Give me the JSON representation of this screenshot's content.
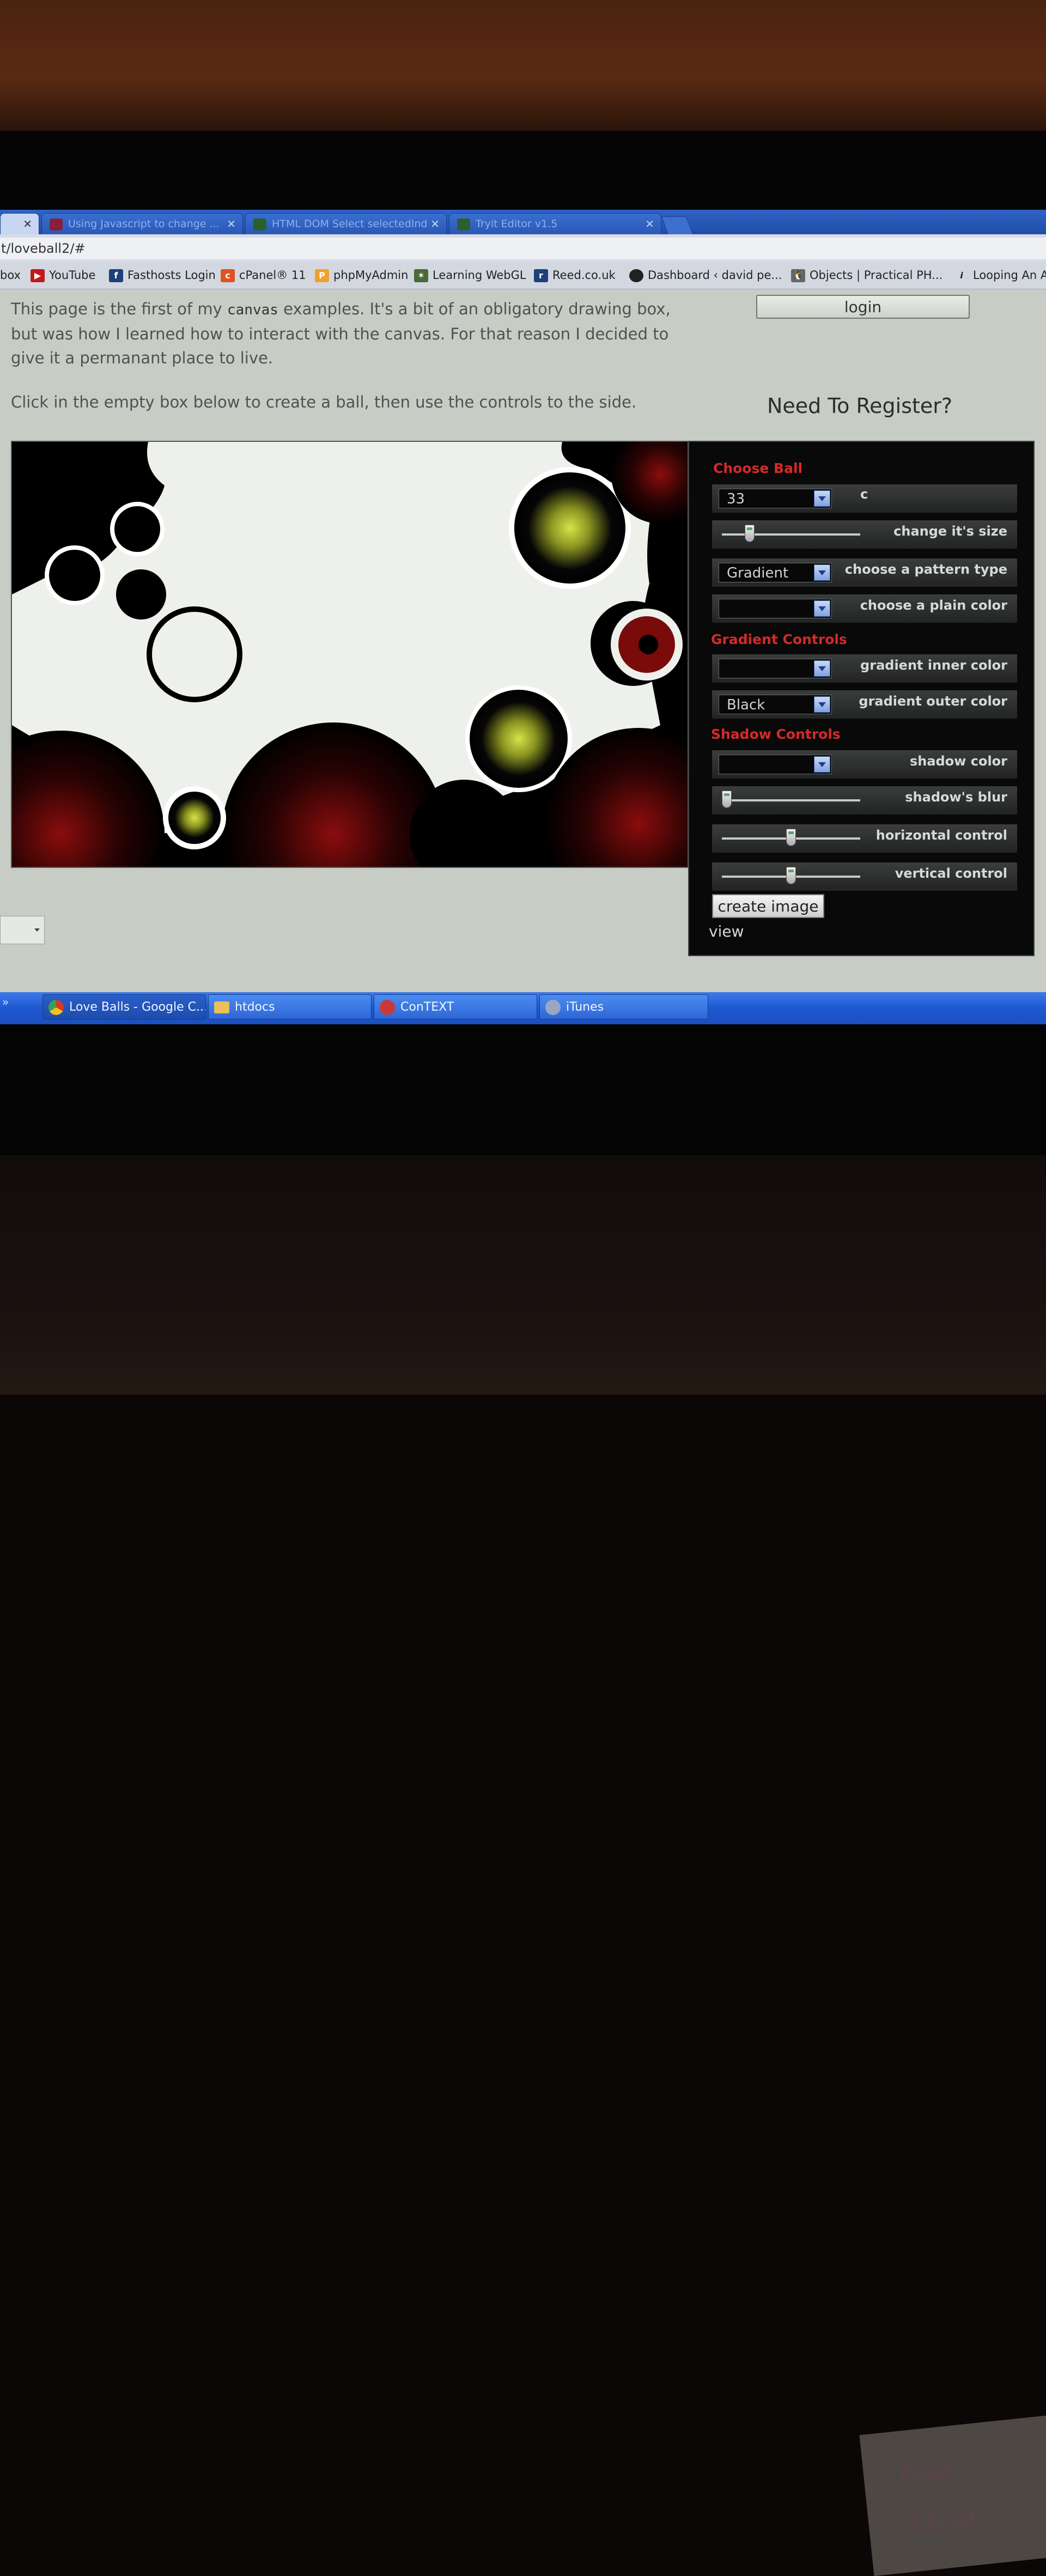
{
  "browser": {
    "tabs": [
      {
        "label": "",
        "active": true
      },
      {
        "label": "Using Javascript to change ...",
        "active": false
      },
      {
        "label": "HTML DOM Select selectedInd",
        "active": false
      },
      {
        "label": "Tryit Editor v1.5",
        "active": false
      }
    ],
    "address": "t/loveball2/#",
    "bookmarks": [
      "box",
      "YouTube",
      "Fasthosts Login",
      "cPanel® 11",
      "phpMyAdmin",
      "Learning WebGL",
      "Reed.co.uk",
      "Dashboard ‹ david pe...",
      "Objects | Practical PH...",
      "Looping An A"
    ]
  },
  "page": {
    "intro_before": "This page is the first of my ",
    "intro_code": "canvas",
    "intro_after": " examples. It's a bit of an obligatory drawing box, but was how I learned how to interact with the canvas. For that reason I decided to give it a permanant place to live.",
    "instruction": "Click in the empty box below to create a ball, then use the controls to the side.",
    "login_label": "login",
    "register_heading": "Need To Register?"
  },
  "controls": {
    "choose_ball_title": "Choose Ball",
    "ball_select_value": "33",
    "ball_select_extra": "c",
    "size_label": "change it's size",
    "size_level": 0.18,
    "pattern_select_value": "Gradient",
    "pattern_label": "choose a pattern type",
    "plain_color_value": "",
    "plain_color_label": "choose a plain color",
    "gradient_title": "Gradient Controls",
    "inner_color_value": "",
    "inner_color_label": "gradient inner color",
    "outer_color_value": "Black",
    "outer_color_label": "gradient outer color",
    "shadow_title": "Shadow Controls",
    "shadow_color_value": "",
    "shadow_color_label": "shadow color",
    "blur_label": "shadow's blur",
    "blur_level": 0.0,
    "horizontal_label": "horizontal control",
    "horizontal_level": 0.5,
    "vertical_label": "vertical control",
    "vertical_level": 0.5,
    "create_label": "create image",
    "view_label": "view"
  },
  "taskbar": {
    "quick": "»",
    "items": [
      "Love Balls - Google C...",
      "htdocs",
      "ConTEXT",
      "iTunes"
    ]
  },
  "desk_note": [
    "Pixie",
    "Christ"
  ],
  "colors": {
    "accent_red": "#d42a2a",
    "canvas_bg": "#000000",
    "canvas_white": "#eef0ec",
    "ball_yellow": "#c8d23a",
    "ball_red": "#8a0c0c",
    "taskbar_blue": "#2a63d6"
  }
}
